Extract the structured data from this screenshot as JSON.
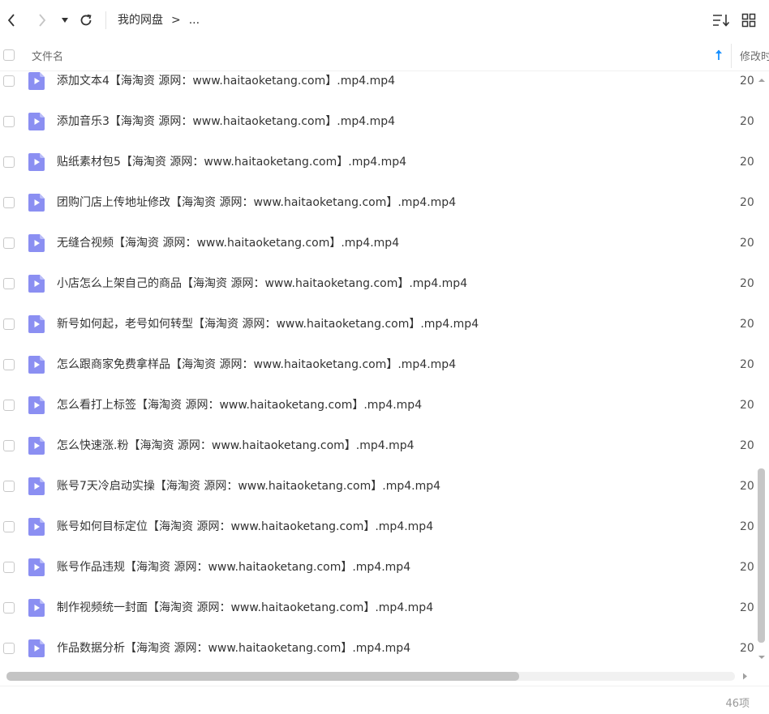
{
  "toolbar": {
    "back_icon": "chevron-left-icon",
    "forward_icon": "chevron-right-icon",
    "history_dropdown_icon": "caret-down-icon",
    "refresh_icon": "refresh-icon",
    "sort_icon": "sort-list-icon",
    "view_icon": "grid-view-icon"
  },
  "breadcrumb": {
    "root": "我的网盘",
    "separator": ">",
    "overflow": "..."
  },
  "header": {
    "name_col": "文件名",
    "modified_col": "修改时",
    "sort_direction": "ascending"
  },
  "files": [
    {
      "name": "添加文本4【海淘资 源网：www.haitaoketang.com】.mp4.mp4",
      "modified": "20"
    },
    {
      "name": "添加音乐3【海淘资 源网：www.haitaoketang.com】.mp4.mp4",
      "modified": "20"
    },
    {
      "name": "贴纸素材包5【海淘资 源网：www.haitaoketang.com】.mp4.mp4",
      "modified": "20"
    },
    {
      "name": "团购门店上传地址修改【海淘资 源网：www.haitaoketang.com】.mp4.mp4",
      "modified": "20"
    },
    {
      "name": "无缝合视频【海淘资 源网：www.haitaoketang.com】.mp4.mp4",
      "modified": "20"
    },
    {
      "name": "小店怎么上架自己的商品【海淘资 源网：www.haitaoketang.com】.mp4.mp4",
      "modified": "20"
    },
    {
      "name": "新号如何起，老号如何转型【海淘资 源网：www.haitaoketang.com】.mp4.mp4",
      "modified": "20"
    },
    {
      "name": "怎么跟商家免费拿样品【海淘资 源网：www.haitaoketang.com】.mp4.mp4",
      "modified": "20"
    },
    {
      "name": "怎么看打上标签【海淘资 源网：www.haitaoketang.com】.mp4.mp4",
      "modified": "20"
    },
    {
      "name": "怎么快速涨.粉【海淘资 源网：www.haitaoketang.com】.mp4.mp4",
      "modified": "20"
    },
    {
      "name": "账号7天冷启动实操【海淘资 源网：www.haitaoketang.com】.mp4.mp4",
      "modified": "20"
    },
    {
      "name": "账号如何目标定位【海淘资 源网：www.haitaoketang.com】.mp4.mp4",
      "modified": "20"
    },
    {
      "name": "账号作品违规【海淘资 源网：www.haitaoketang.com】.mp4.mp4",
      "modified": "20"
    },
    {
      "name": "制作视频统一封面【海淘资 源网：www.haitaoketang.com】.mp4.mp4",
      "modified": "20"
    },
    {
      "name": "作品数据分析【海淘资 源网：www.haitaoketang.com】.mp4.mp4",
      "modified": "20"
    }
  ],
  "file_icon": "video-file-icon",
  "file_icon_color": "#8b8ff2",
  "accent_color": "#1890ff",
  "status": {
    "count": "46项"
  }
}
